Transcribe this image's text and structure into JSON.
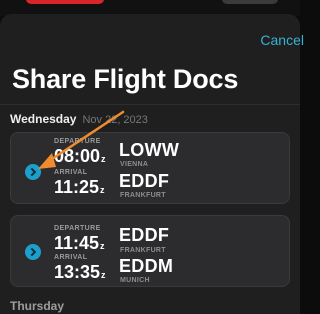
{
  "header": {
    "cancel_label": "Cancel",
    "title": "Share Flight Docs"
  },
  "days": [
    {
      "weekday": "Wednesday",
      "date": "Nov 22, 2023",
      "flights": [
        {
          "departure_label": "DEPARTURE",
          "departure_time": "08:00",
          "arrival_label": "ARRIVAL",
          "arrival_time": "11:25",
          "zulu": "z",
          "from_icao": "LOWW",
          "from_city": "VIENNA",
          "to_icao": "EDDF",
          "to_city": "FRANKFURT"
        },
        {
          "departure_label": "DEPARTURE",
          "departure_time": "11:45",
          "arrival_label": "ARRIVAL",
          "arrival_time": "13:35",
          "zulu": "z",
          "from_icao": "EDDF",
          "from_city": "FRANKFURT",
          "to_icao": "EDDM",
          "to_city": "MUNICH"
        }
      ]
    }
  ],
  "next_day_label": "Thursday",
  "colors": {
    "accent": "#3ab0d4",
    "selection_dot": "#1d9fcb",
    "annotation_arrow": "#f08c2e"
  }
}
